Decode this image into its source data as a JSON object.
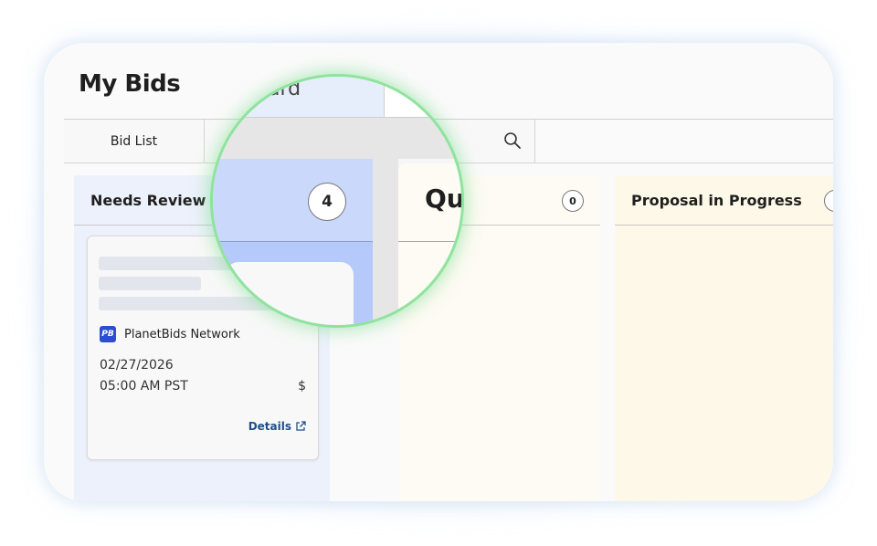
{
  "app": {
    "title": "My Bids"
  },
  "tabs": {
    "bid_list": "Bid List",
    "board_partial": "ard"
  },
  "columns": [
    {
      "title": "Needs Review",
      "count": "4"
    },
    {
      "title": "Qu",
      "count": "0"
    },
    {
      "title": "Proposal in Progress",
      "count": ""
    }
  ],
  "bid_card": {
    "source": "PlanetBids Network",
    "source_logo": "PB",
    "date": "02/27/2026",
    "time": "05:00 AM PST",
    "amount": "$",
    "details_label": "Details"
  },
  "magnifier": {
    "count": "4",
    "column_partial": "Qu"
  },
  "colors": {
    "accent_link": "#1f4f8a",
    "review_column": "#edf1fb",
    "queue_column": "#fdfbf3",
    "proposal_column": "#fdf8e8",
    "magnifier_ring": "#8fe39d",
    "source_logo": "#2b4fd0"
  },
  "icons": {
    "search": "search-icon",
    "external_link": "external-link-icon"
  }
}
